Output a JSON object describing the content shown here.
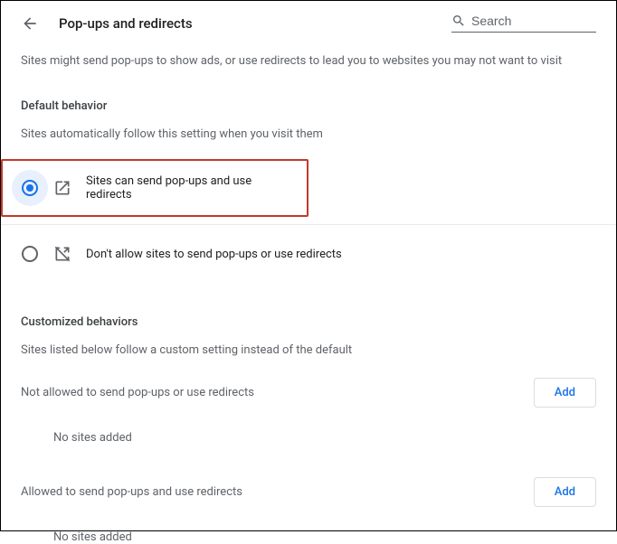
{
  "header": {
    "title": "Pop-ups and redirects",
    "search_placeholder": "Search"
  },
  "intro": "Sites might send pop-ups to show ads, or use redirects to lead you to websites you may not want to visit",
  "default_behavior": {
    "heading": "Default behavior",
    "subtext": "Sites automatically follow this setting when you visit them",
    "options": [
      {
        "label": "Sites can send pop-ups and use redirects",
        "selected": true
      },
      {
        "label": "Don't allow sites to send pop-ups or use redirects",
        "selected": false
      }
    ]
  },
  "customized": {
    "heading": "Customized behaviors",
    "subtext": "Sites listed below follow a custom setting instead of the default"
  },
  "not_allowed": {
    "title": "Not allowed to send pop-ups or use redirects",
    "add_label": "Add",
    "empty": "No sites added"
  },
  "allowed": {
    "title": "Allowed to send pop-ups and use redirects",
    "add_label": "Add",
    "empty": "No sites added"
  }
}
